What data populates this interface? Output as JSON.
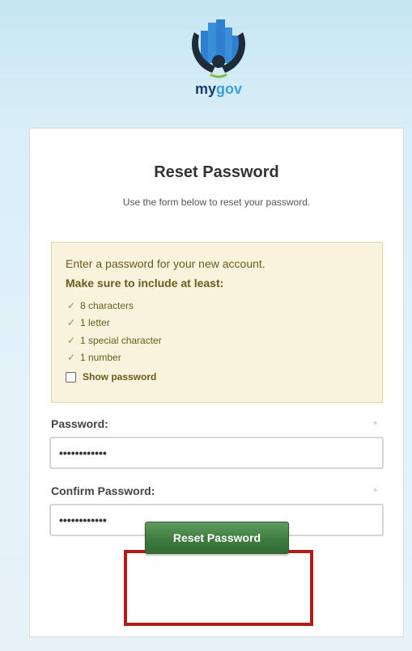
{
  "brand": {
    "logo_text_my": "my",
    "logo_text_gov": "gov",
    "colors": {
      "navy": "#1b3b73",
      "blue": "#3aa0dc"
    }
  },
  "card": {
    "title": "Reset Password",
    "subtitle": "Use the form below to reset your password."
  },
  "notice": {
    "line1": "Enter a password for your new account.",
    "line2": "Make sure to include at least:",
    "requirements": [
      "8 characters",
      "1 letter",
      "1 special character",
      "1 number"
    ],
    "check_icon": "check-icon",
    "show_password_label": "Show password",
    "show_password_checked": false
  },
  "form": {
    "password_label": "Password:",
    "password_value": "••••••••••••",
    "confirm_label": "Confirm Password:",
    "confirm_value": "••••••••••••",
    "required_marker": "*"
  },
  "actions": {
    "reset_button_label": "Reset Password",
    "button_color": "#3f7c40",
    "highlight_color": "#b31b1b"
  }
}
